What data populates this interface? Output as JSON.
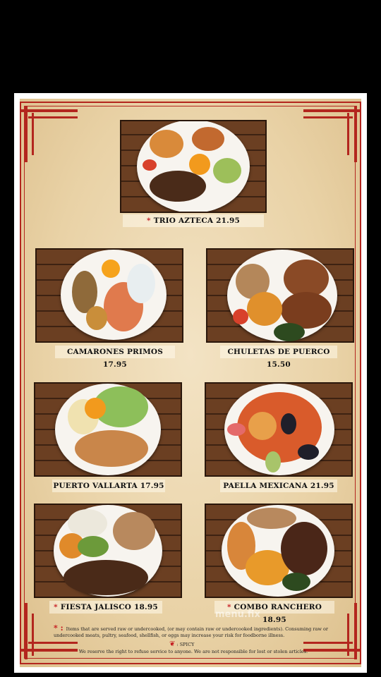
{
  "dishes": [
    {
      "name": "TRIO AZTECA 21.95",
      "star": true
    },
    {
      "name": "CAMARONES PRIMOS 17.95",
      "star": false
    },
    {
      "name": "CHULETAS DE PUERCO 15.50",
      "star": false
    },
    {
      "name": "PUERTO VALLARTA 17.95",
      "star": false
    },
    {
      "name": "PAELLA MEXICANA 21.95",
      "star": false
    },
    {
      "name": "FIESTA JALISCO 18.95",
      "star": true
    },
    {
      "name": "COMBO RANCHERO 18.95",
      "star": true
    }
  ],
  "star_symbol": "*",
  "footnote": {
    "marker": "* :",
    "text": "Items that are served raw or undercooked, (or may contain raw or undercooked ingredients). Consuming raw or undercooked meats, pultry, seafood, shellfish, or eggs may increase your risk for foodborne illness.",
    "spicy_label": ": SPICY",
    "notice": "We reserve the right to refuse service to anyone. We are not responsible for lost or stolen articles."
  },
  "watermark": "menu.fix",
  "colors": {
    "accent": "#b3261e",
    "paper": "#ecd6ab",
    "wood": "#5a331b"
  }
}
